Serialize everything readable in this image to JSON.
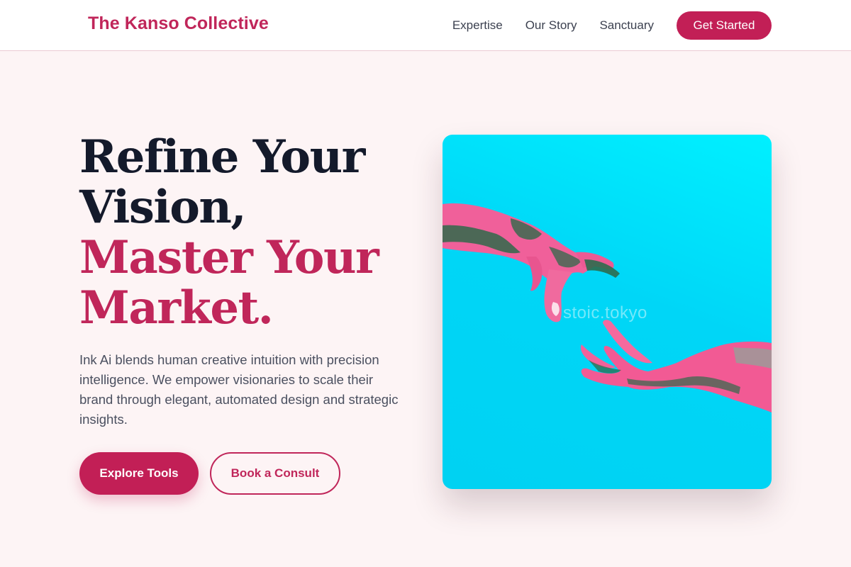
{
  "header": {
    "brand": "The Kanso Collective",
    "nav": [
      "Expertise",
      "Our Story",
      "Sanctuary"
    ],
    "cta": "Get Started"
  },
  "hero": {
    "title_lines": [
      "Refine Your",
      "Vision,",
      "Master Your",
      "Market."
    ],
    "description": "Ink Ai blends human creative intuition with precision intelligence. We empower visionaries to scale their brand through elegant, automated design and strategic insights.",
    "primary_button": "Explore Tools",
    "secondary_button": "Book a Consult"
  },
  "image": {
    "watermark": "stoic.tokyo",
    "subject": "robotic hand reaching toward human hand"
  },
  "colors": {
    "accent": "#c0265a",
    "background": "#fdf4f5",
    "heading": "#141a2b",
    "image_bg": "#00dcf5"
  }
}
